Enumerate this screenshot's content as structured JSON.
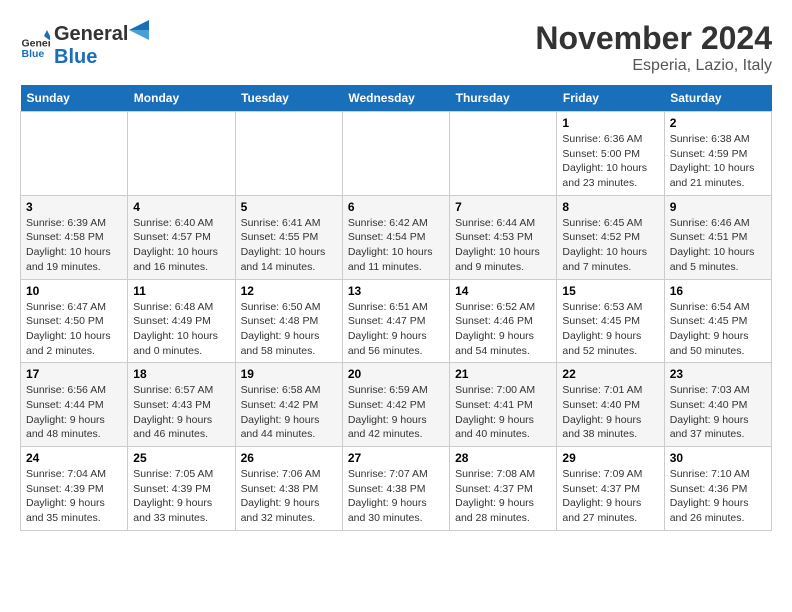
{
  "header": {
    "logo_general": "General",
    "logo_blue": "Blue",
    "month_title": "November 2024",
    "location": "Esperia, Lazio, Italy"
  },
  "weekdays": [
    "Sunday",
    "Monday",
    "Tuesday",
    "Wednesday",
    "Thursday",
    "Friday",
    "Saturday"
  ],
  "weeks": [
    [
      {
        "day": "",
        "info": ""
      },
      {
        "day": "",
        "info": ""
      },
      {
        "day": "",
        "info": ""
      },
      {
        "day": "",
        "info": ""
      },
      {
        "day": "",
        "info": ""
      },
      {
        "day": "1",
        "info": "Sunrise: 6:36 AM\nSunset: 5:00 PM\nDaylight: 10 hours and 23 minutes."
      },
      {
        "day": "2",
        "info": "Sunrise: 6:38 AM\nSunset: 4:59 PM\nDaylight: 10 hours and 21 minutes."
      }
    ],
    [
      {
        "day": "3",
        "info": "Sunrise: 6:39 AM\nSunset: 4:58 PM\nDaylight: 10 hours and 19 minutes."
      },
      {
        "day": "4",
        "info": "Sunrise: 6:40 AM\nSunset: 4:57 PM\nDaylight: 10 hours and 16 minutes."
      },
      {
        "day": "5",
        "info": "Sunrise: 6:41 AM\nSunset: 4:55 PM\nDaylight: 10 hours and 14 minutes."
      },
      {
        "day": "6",
        "info": "Sunrise: 6:42 AM\nSunset: 4:54 PM\nDaylight: 10 hours and 11 minutes."
      },
      {
        "day": "7",
        "info": "Sunrise: 6:44 AM\nSunset: 4:53 PM\nDaylight: 10 hours and 9 minutes."
      },
      {
        "day": "8",
        "info": "Sunrise: 6:45 AM\nSunset: 4:52 PM\nDaylight: 10 hours and 7 minutes."
      },
      {
        "day": "9",
        "info": "Sunrise: 6:46 AM\nSunset: 4:51 PM\nDaylight: 10 hours and 5 minutes."
      }
    ],
    [
      {
        "day": "10",
        "info": "Sunrise: 6:47 AM\nSunset: 4:50 PM\nDaylight: 10 hours and 2 minutes."
      },
      {
        "day": "11",
        "info": "Sunrise: 6:48 AM\nSunset: 4:49 PM\nDaylight: 10 hours and 0 minutes."
      },
      {
        "day": "12",
        "info": "Sunrise: 6:50 AM\nSunset: 4:48 PM\nDaylight: 9 hours and 58 minutes."
      },
      {
        "day": "13",
        "info": "Sunrise: 6:51 AM\nSunset: 4:47 PM\nDaylight: 9 hours and 56 minutes."
      },
      {
        "day": "14",
        "info": "Sunrise: 6:52 AM\nSunset: 4:46 PM\nDaylight: 9 hours and 54 minutes."
      },
      {
        "day": "15",
        "info": "Sunrise: 6:53 AM\nSunset: 4:45 PM\nDaylight: 9 hours and 52 minutes."
      },
      {
        "day": "16",
        "info": "Sunrise: 6:54 AM\nSunset: 4:45 PM\nDaylight: 9 hours and 50 minutes."
      }
    ],
    [
      {
        "day": "17",
        "info": "Sunrise: 6:56 AM\nSunset: 4:44 PM\nDaylight: 9 hours and 48 minutes."
      },
      {
        "day": "18",
        "info": "Sunrise: 6:57 AM\nSunset: 4:43 PM\nDaylight: 9 hours and 46 minutes."
      },
      {
        "day": "19",
        "info": "Sunrise: 6:58 AM\nSunset: 4:42 PM\nDaylight: 9 hours and 44 minutes."
      },
      {
        "day": "20",
        "info": "Sunrise: 6:59 AM\nSunset: 4:42 PM\nDaylight: 9 hours and 42 minutes."
      },
      {
        "day": "21",
        "info": "Sunrise: 7:00 AM\nSunset: 4:41 PM\nDaylight: 9 hours and 40 minutes."
      },
      {
        "day": "22",
        "info": "Sunrise: 7:01 AM\nSunset: 4:40 PM\nDaylight: 9 hours and 38 minutes."
      },
      {
        "day": "23",
        "info": "Sunrise: 7:03 AM\nSunset: 4:40 PM\nDaylight: 9 hours and 37 minutes."
      }
    ],
    [
      {
        "day": "24",
        "info": "Sunrise: 7:04 AM\nSunset: 4:39 PM\nDaylight: 9 hours and 35 minutes."
      },
      {
        "day": "25",
        "info": "Sunrise: 7:05 AM\nSunset: 4:39 PM\nDaylight: 9 hours and 33 minutes."
      },
      {
        "day": "26",
        "info": "Sunrise: 7:06 AM\nSunset: 4:38 PM\nDaylight: 9 hours and 32 minutes."
      },
      {
        "day": "27",
        "info": "Sunrise: 7:07 AM\nSunset: 4:38 PM\nDaylight: 9 hours and 30 minutes."
      },
      {
        "day": "28",
        "info": "Sunrise: 7:08 AM\nSunset: 4:37 PM\nDaylight: 9 hours and 28 minutes."
      },
      {
        "day": "29",
        "info": "Sunrise: 7:09 AM\nSunset: 4:37 PM\nDaylight: 9 hours and 27 minutes."
      },
      {
        "day": "30",
        "info": "Sunrise: 7:10 AM\nSunset: 4:36 PM\nDaylight: 9 hours and 26 minutes."
      }
    ]
  ]
}
